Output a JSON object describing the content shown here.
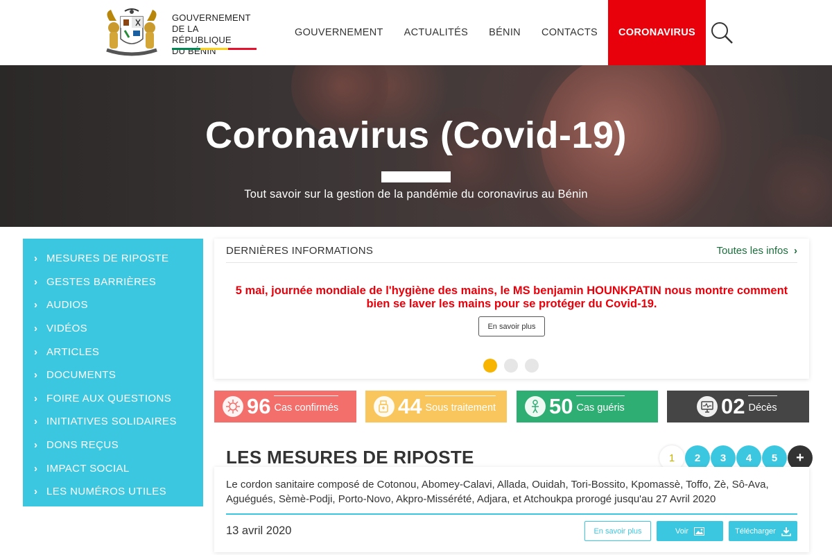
{
  "header": {
    "brand_lines": [
      "GOUVERNEMENT",
      "DE LA RÉPUBLIQUE",
      "DU BÉNIN"
    ],
    "flag_colors": [
      "#008751",
      "#fcd116",
      "#e8112d"
    ],
    "nav": [
      "GOUVERNEMENT",
      "ACTUALITÉS",
      "BÉNIN",
      "CONTACTS",
      "CORONAVIRUS"
    ],
    "active_nav": "CORONAVIRUS",
    "search_icon": "search-icon"
  },
  "hero": {
    "title": "Coronavirus (Covid-19)",
    "subtitle": "Tout savoir sur la gestion de la pandémie du coronavirus au Bénin"
  },
  "sidebar": {
    "items": [
      {
        "label": "MESURES DE RIPOSTE"
      },
      {
        "label": "GESTES BARRIÈRES"
      },
      {
        "label": "AUDIOS"
      },
      {
        "label": "VIDÉOS"
      },
      {
        "label": "ARTICLES"
      },
      {
        "label": "DOCUMENTS"
      },
      {
        "label": "FOIRE AUX QUESTIONS"
      },
      {
        "label": "INITIATIVES SOLIDAIRES"
      },
      {
        "label": "DONS REÇUS"
      },
      {
        "label": "IMPACT SOCIAL"
      },
      {
        "label": "LES NUMÉROS UTILES"
      }
    ]
  },
  "news": {
    "title": "DERNIÈRES INFORMATIONS",
    "all_link": "Toutes les infos",
    "headline": "5 mai, journée mondiale de l'hygiène des mains, le MS benjamin HOUNKPATIN nous montre comment bien se laver les mains pour se protéger du Covid-19.",
    "more_button": "En savoir plus",
    "slide_count": 3,
    "active_slide": 1
  },
  "stats": [
    {
      "value": "96",
      "label": "Cas confirmés",
      "color": "#f36f6b",
      "icon": "virus-icon"
    },
    {
      "value": "44",
      "label": "Sous traitement",
      "color": "#f8c65c",
      "icon": "medicine-icon"
    },
    {
      "value": "50",
      "label": "Cas guéris",
      "color": "#2fae73",
      "icon": "person-icon"
    },
    {
      "value": "02",
      "label": "Décès",
      "color": "#454545",
      "icon": "monitor-icon"
    }
  ],
  "measures": {
    "title": "LES MESURES DE RIPOSTE",
    "pages": [
      "1",
      "2",
      "3",
      "4",
      "5",
      "+"
    ],
    "current_page": "1",
    "item_text": "Le cordon sanitaire composé de Cotonou, Abomey-Calavi, Allada, Ouidah, Tori-Bossito, Kpomassè, Toffo, Zè, Sô-Ava, Aguégués, Sèmè-Podji, Porto-Novo, Akpro-Missérété, Adjara, et Atchoukpa prorogé jusqu'au 27 Avril 2020",
    "item_date": "13 avril 2020",
    "btn_more": "En savoir plus",
    "btn_view": "Voir",
    "btn_download": "Télécharger"
  }
}
